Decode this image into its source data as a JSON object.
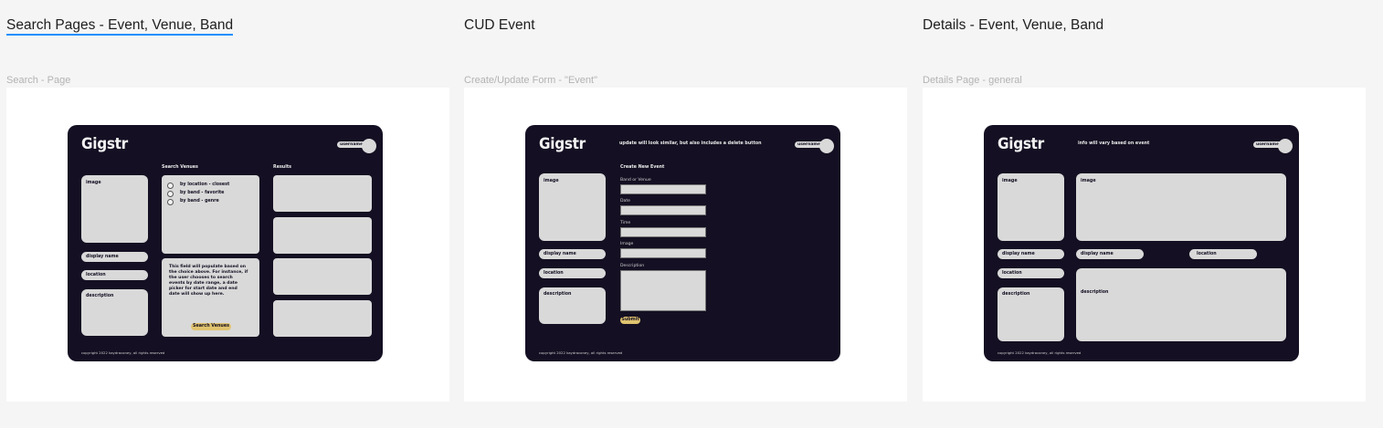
{
  "sections": [
    {
      "title": "Search Pages - Event, Venue, Band",
      "frame_label": "Search - Page"
    },
    {
      "title": "CUD Event",
      "frame_label": "Create/Update Form - \"Event\""
    },
    {
      "title": "Details - Event, Venue, Band",
      "frame_label": "Details Page - general"
    }
  ],
  "app": {
    "logo": "Gigstr",
    "username": "username",
    "copyright": "copyright 2022 kaydraconey, all rights reserved"
  },
  "search": {
    "image": "image",
    "display_name": "display name",
    "location": "location",
    "description": "description",
    "venues_heading": "Search Venues",
    "results_heading": "Results",
    "radio_options": [
      "by location - closest",
      "by band - favorite",
      "by band - genre"
    ],
    "info_text": "This field will populate based on the choice above.  For instance,  if the user chooses to search events by date range, a date picker for start date and end date will show up here.",
    "search_button": "Search Venues"
  },
  "cud": {
    "note": "update will look similar, but also includes a delete button",
    "image": "image",
    "display_name": "display name",
    "location": "location",
    "description": "description",
    "form_heading": "Create New Event",
    "fields": [
      "Band or Venue",
      "Date",
      "Time",
      "Image",
      "Description"
    ],
    "submit": "Submit"
  },
  "details": {
    "note": "info will vary based on event",
    "image_left": "image",
    "image_right": "image",
    "display_name_left": "display name",
    "display_name_right": "display name",
    "location_left": "location",
    "location_right": "location",
    "description_left": "description",
    "description_right": "description"
  }
}
